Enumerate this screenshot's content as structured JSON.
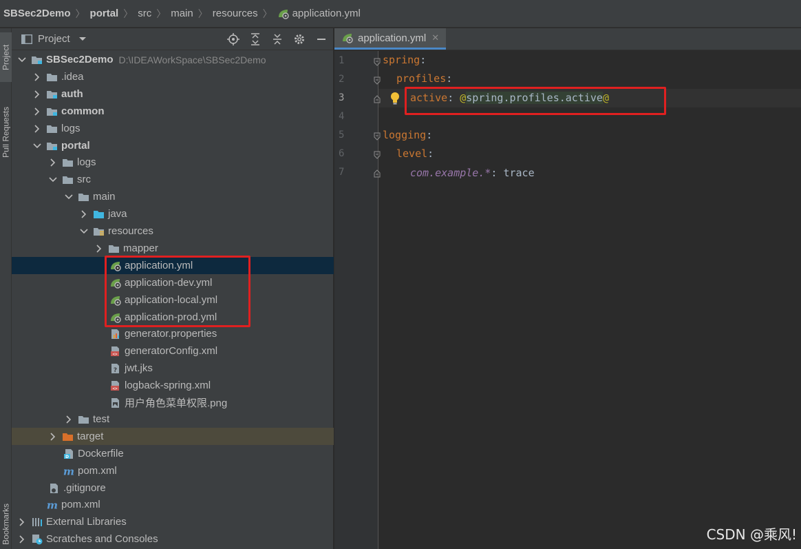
{
  "breadcrumb": {
    "items": [
      "SBSec2Demo",
      "portal",
      "src",
      "main",
      "resources",
      "application.yml"
    ]
  },
  "toolstrip": {
    "project_tab": "Project",
    "pull_requests_tab": "Pull Requests",
    "bookmarks_tab": "Bookmarks"
  },
  "project_panel": {
    "title": "Project",
    "tree": [
      {
        "label": "SBSec2Demo",
        "path": "D:\\IDEAWorkSpace\\SBSec2Demo"
      },
      {
        "label": ".idea"
      },
      {
        "label": "auth"
      },
      {
        "label": "common"
      },
      {
        "label": "logs"
      },
      {
        "label": "portal"
      },
      {
        "label": "logs"
      },
      {
        "label": "src"
      },
      {
        "label": "main"
      },
      {
        "label": "java"
      },
      {
        "label": "resources"
      },
      {
        "label": "mapper"
      },
      {
        "label": "application.yml"
      },
      {
        "label": "application-dev.yml"
      },
      {
        "label": "application-local.yml"
      },
      {
        "label": "application-prod.yml"
      },
      {
        "label": "generator.properties"
      },
      {
        "label": "generatorConfig.xml"
      },
      {
        "label": "jwt.jks"
      },
      {
        "label": "logback-spring.xml"
      },
      {
        "label": "用户角色菜单权限.png"
      },
      {
        "label": "test"
      },
      {
        "label": "target"
      },
      {
        "label": "Dockerfile"
      },
      {
        "label": "pom.xml"
      },
      {
        "label": ".gitignore"
      },
      {
        "label": "pom.xml"
      },
      {
        "label": "External Libraries"
      },
      {
        "label": "Scratches and Consoles"
      }
    ]
  },
  "editor": {
    "tab_label": "application.yml",
    "line_numbers": [
      "1",
      "2",
      "3",
      "4",
      "5",
      "6",
      "7"
    ],
    "code": {
      "l1_key": "spring",
      "l1_colon": ":",
      "l2_key": "profiles",
      "l2_colon": ":",
      "l3_key": "active",
      "l3_colon": ": ",
      "l3_at1": "@",
      "l3_value": "spring.profiles.active",
      "l3_at2": "@",
      "l5_key": "logging",
      "l5_colon": ":",
      "l6_key": "level",
      "l6_colon": ":",
      "l7_key": "com.example.*",
      "l7_colon": ": ",
      "l7_value": "trace"
    }
  },
  "watermark": "CSDN @乘风!",
  "colors": {
    "accent": "#4a88c7",
    "highlight_box": "#e02020",
    "yaml_key": "#cc7832",
    "annotation": "#bbb529",
    "selection": "#0d293e"
  }
}
